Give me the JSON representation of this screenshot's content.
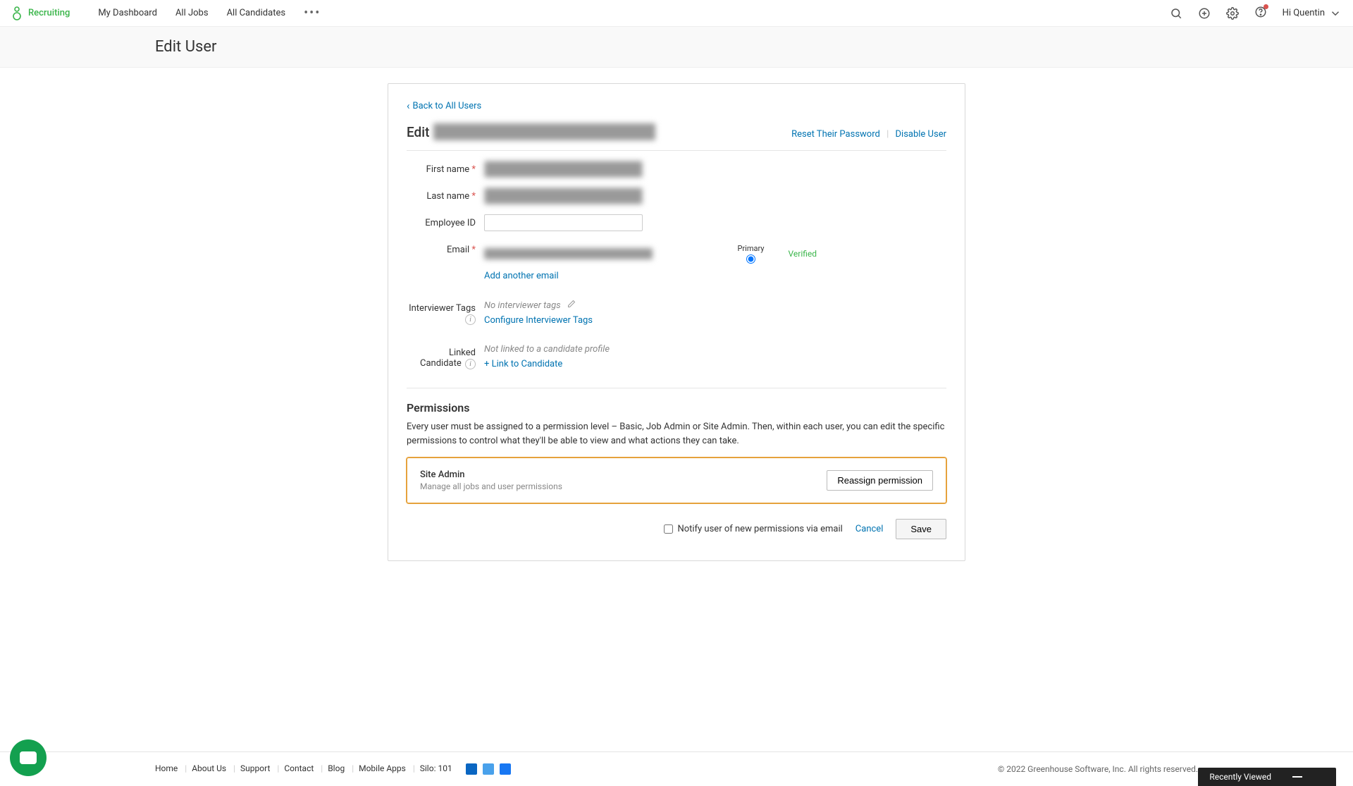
{
  "nav": {
    "product": "Recruiting",
    "links": [
      "My Dashboard",
      "All Jobs",
      "All Candidates"
    ],
    "user_greeting": "Hi Quentin"
  },
  "page": {
    "title": "Edit User",
    "back_link": "Back to All Users",
    "edit_label": "Edit",
    "edit_name_redacted": "████████ ███████████████",
    "reset_pw": "Reset Their Password",
    "disable_user": "Disable User"
  },
  "form": {
    "first_name": {
      "label": "First name",
      "value": "██████"
    },
    "last_name": {
      "label": "Last name",
      "value": "████████████"
    },
    "employee_id": {
      "label": "Employee ID",
      "value": ""
    },
    "email": {
      "label": "Email",
      "value": "██████████████████████████",
      "primary_header": "Primary",
      "verified": "Verified",
      "add_another": "Add another email"
    },
    "interviewer_tags": {
      "label": "Interviewer Tags",
      "none_text": "No interviewer tags",
      "configure": "Configure Interviewer Tags"
    },
    "linked_candidate": {
      "label": "Linked Candidate",
      "none_text": "Not linked to a candidate profile",
      "link_action": "+ Link to Candidate"
    }
  },
  "permissions": {
    "heading": "Permissions",
    "desc": "Every user must be assigned to a permission level – Basic, Job Admin or Site Admin. Then, within each user, you can edit the specific permissions to control what they'll be able to view and what actions they can take.",
    "role_name": "Site Admin",
    "role_desc": "Manage all jobs and user permissions",
    "reassign_btn": "Reassign permission",
    "notify_label": "Notify user of new permissions via email",
    "cancel": "Cancel",
    "save": "Save"
  },
  "footer": {
    "links": [
      "Home",
      "About Us",
      "Support",
      "Contact",
      "Blog",
      "Mobile Apps",
      "Silo: 101"
    ],
    "copyright": "© 2022 Greenhouse Software, Inc. All rights reserved."
  },
  "recently_viewed": "Recently Viewed",
  "icons": {
    "search": "search-icon",
    "plus": "plus-icon",
    "gear": "gear-icon",
    "help": "help-icon",
    "chevron_down": "chevron-down-icon"
  }
}
